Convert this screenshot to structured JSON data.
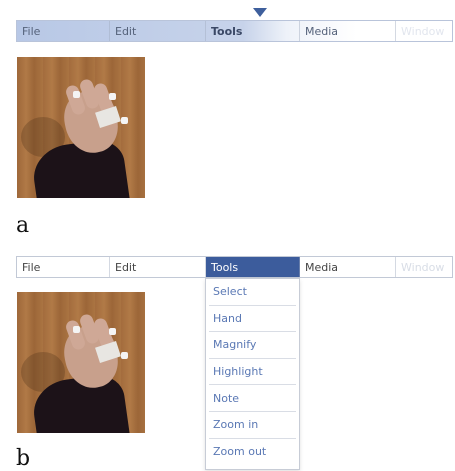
{
  "menu_bar": {
    "items": [
      {
        "label": "File"
      },
      {
        "label": "Edit"
      },
      {
        "label": "Tools"
      },
      {
        "label": "Media"
      },
      {
        "label": "Window"
      }
    ]
  },
  "panels": [
    {
      "label": "a",
      "active_menu": "Tools",
      "dropdown_open": false
    },
    {
      "label": "b",
      "active_menu": "Tools",
      "dropdown_open": true
    }
  ],
  "dropdown": {
    "items": [
      {
        "label": "Select"
      },
      {
        "label": "Hand"
      },
      {
        "label": "Magnify"
      },
      {
        "label": "Highlight"
      },
      {
        "label": "Note"
      },
      {
        "label": "Zoom in"
      },
      {
        "label": "Zoom out"
      }
    ]
  },
  "colors": {
    "active_highlight": "#3c5c9c",
    "pointer": "#3e5f9c",
    "dropdown_text": "#5a78b4"
  }
}
